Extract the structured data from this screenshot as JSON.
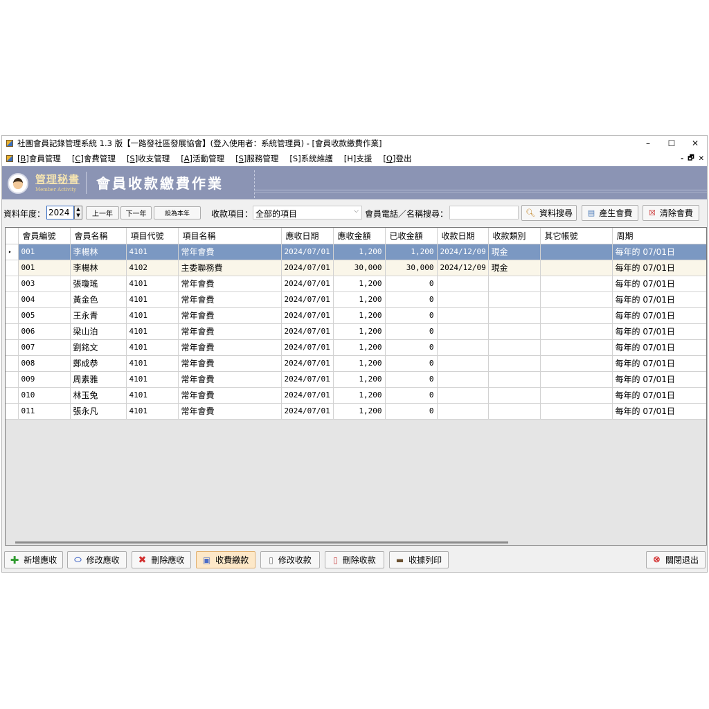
{
  "window": {
    "title": "社團會員記錄管理系統 1.3 版【一路發社區發展協會】(登入使用者：系統管理員) - [會員收款繳費作業]",
    "controls": {
      "minimize": "–",
      "maximize": "☐",
      "close": "✕"
    }
  },
  "menu": {
    "items": [
      {
        "key": "B",
        "label": "會員管理"
      },
      {
        "key": "C",
        "label": "會費管理"
      },
      {
        "key": "S",
        "label": "收支管理"
      },
      {
        "key": "A",
        "label": "活動管理"
      },
      {
        "key": "S",
        "label": "服務管理"
      },
      {
        "key": "S",
        "label": "系統維護"
      },
      {
        "key": "H",
        "label": "支援"
      },
      {
        "key": "Q",
        "label": "登出"
      }
    ],
    "mdi_controls": {
      "minimize": "-",
      "restore": "🗗",
      "close": "✕"
    }
  },
  "banner": {
    "logo_text": "管理秘書",
    "logo_subtext": "Member Activity",
    "title": "會員收款繳費作業"
  },
  "filters": {
    "year_label": "資料年度：",
    "year_value": "2024",
    "prev_year": "上一年",
    "next_year": "下一年",
    "set_this_year": "設為本年",
    "item_label": "收款項目：",
    "item_value": "全部的項目",
    "search_label": "會員電話／名稱搜尋：",
    "search_value": "",
    "search_button": "資料搜尋",
    "generate_button": "產生會費",
    "clear_button": "清除會費"
  },
  "grid": {
    "columns": [
      "會員編號",
      "會員名稱",
      "項目代號",
      "項目名稱",
      "應收日期",
      "應收金額",
      "已收金額",
      "收款日期",
      "收款類別",
      "其它帳號",
      "周期"
    ],
    "rows": [
      [
        "001",
        "李楊林",
        "4101",
        "常年會費",
        "2024/07/01",
        "1,200",
        "1,200",
        "2024/12/09",
        "現金",
        "",
        "每年的 07/01日"
      ],
      [
        "001",
        "李楊林",
        "4102",
        "主委聯務費",
        "2024/07/01",
        "30,000",
        "30,000",
        "2024/12/09",
        "現金",
        "",
        "每年的 07/01日"
      ],
      [
        "003",
        "張瓊瑤",
        "4101",
        "常年會費",
        "2024/07/01",
        "1,200",
        "0",
        "",
        "",
        "",
        "每年的 07/01日"
      ],
      [
        "004",
        "黃金色",
        "4101",
        "常年會費",
        "2024/07/01",
        "1,200",
        "0",
        "",
        "",
        "",
        "每年的 07/01日"
      ],
      [
        "005",
        "王永青",
        "4101",
        "常年會費",
        "2024/07/01",
        "1,200",
        "0",
        "",
        "",
        "",
        "每年的 07/01日"
      ],
      [
        "006",
        "梁山泊",
        "4101",
        "常年會費",
        "2024/07/01",
        "1,200",
        "0",
        "",
        "",
        "",
        "每年的 07/01日"
      ],
      [
        "007",
        "劉銘文",
        "4101",
        "常年會費",
        "2024/07/01",
        "1,200",
        "0",
        "",
        "",
        "",
        "每年的 07/01日"
      ],
      [
        "008",
        "鄭成恭",
        "4101",
        "常年會費",
        "2024/07/01",
        "1,200",
        "0",
        "",
        "",
        "",
        "每年的 07/01日"
      ],
      [
        "009",
        "周素雅",
        "4101",
        "常年會費",
        "2024/07/01",
        "1,200",
        "0",
        "",
        "",
        "",
        "每年的 07/01日"
      ],
      [
        "010",
        "林玉兔",
        "4101",
        "常年會費",
        "2024/07/01",
        "1,200",
        "0",
        "",
        "",
        "",
        "每年的 07/01日"
      ],
      [
        "011",
        "張永凡",
        "4101",
        "常年會費",
        "2024/07/01",
        "1,200",
        "0",
        "",
        "",
        "",
        "每年的 07/01日"
      ]
    ],
    "selected_marker": "▸"
  },
  "actions": {
    "add_receivable": "新增應收",
    "edit_receivable": "修改應收",
    "delete_receivable": "刪除應收",
    "collect_payment": "收費繳款",
    "edit_payment": "修改收款",
    "delete_payment": "刪除收款",
    "print_receipt": "收據列印",
    "close_exit": "關閉退出"
  },
  "colors": {
    "banner": "#8b94b4",
    "selected_row": "#7b98c2",
    "alt_row": "#faf6e9",
    "active_button": "#fde8c8"
  }
}
